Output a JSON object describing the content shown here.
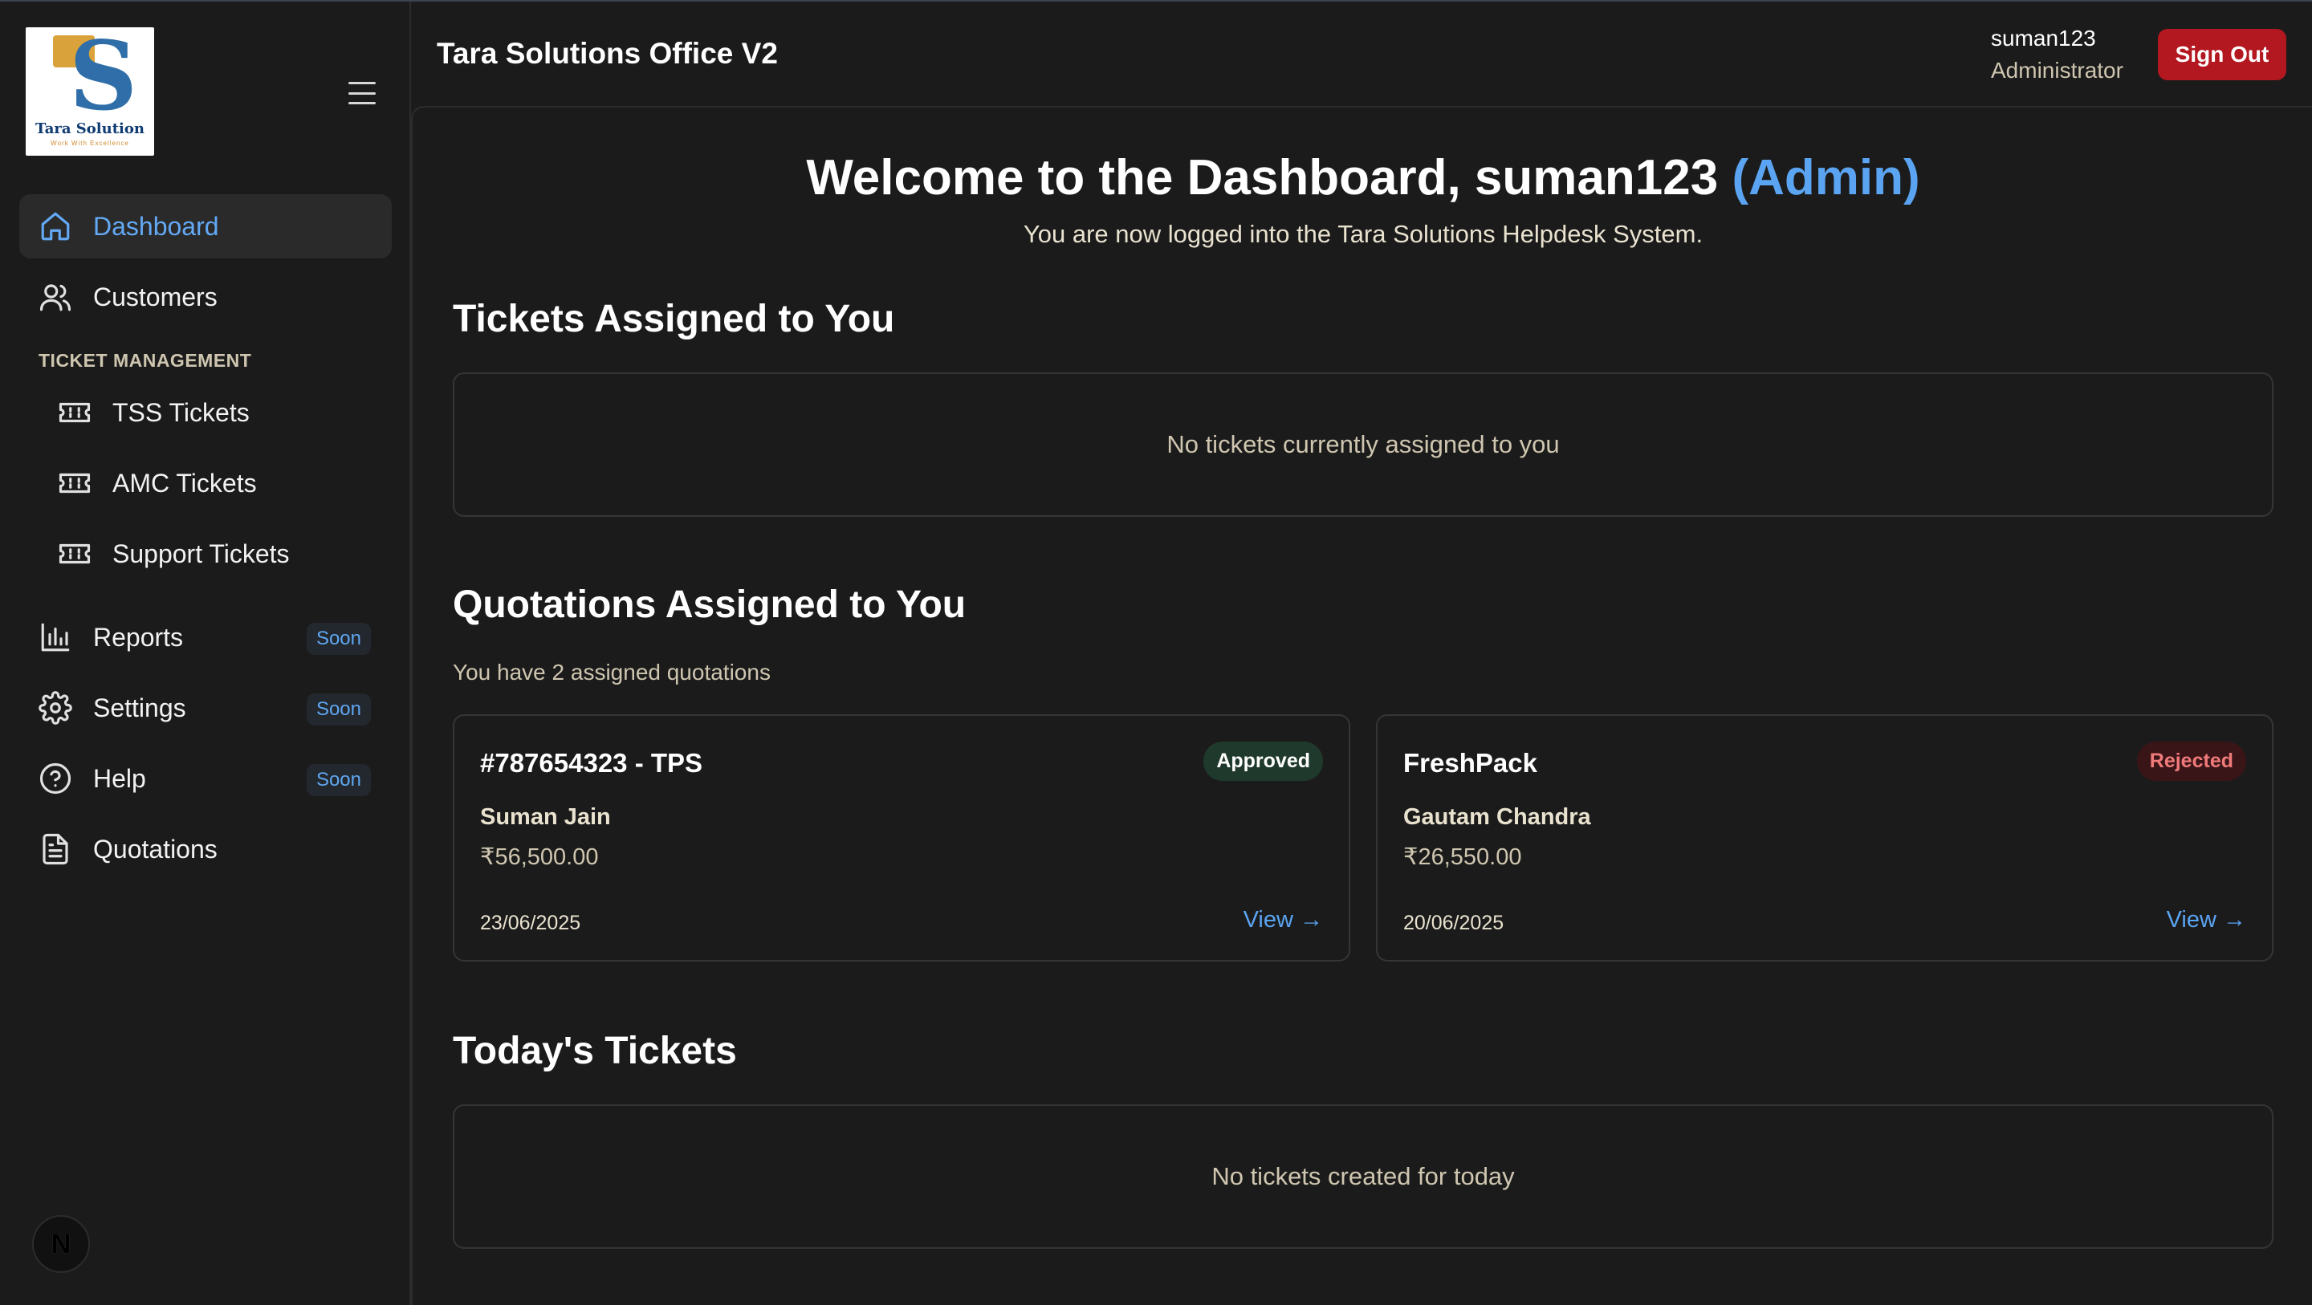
{
  "brand": {
    "logo_name": "Tara Solution",
    "logo_tagline": "Work With Excellence"
  },
  "header": {
    "title": "Tara Solutions Office V2",
    "user_name": "suman123",
    "user_role": "Administrator",
    "signout_label": "Sign Out"
  },
  "sidebar": {
    "items": [
      {
        "label": "Dashboard",
        "icon": "home-icon"
      },
      {
        "label": "Customers",
        "icon": "users-icon"
      }
    ],
    "section_label": "TICKET MANAGEMENT",
    "ticket_items": [
      {
        "label": "TSS Tickets",
        "icon": "ticket-icon"
      },
      {
        "label": "AMC Tickets",
        "icon": "ticket-icon"
      },
      {
        "label": "Support Tickets",
        "icon": "ticket-icon"
      }
    ],
    "other_items": [
      {
        "label": "Reports",
        "icon": "bar-chart-icon",
        "badge": "Soon"
      },
      {
        "label": "Settings",
        "icon": "gear-icon",
        "badge": "Soon"
      },
      {
        "label": "Help",
        "icon": "help-circle-icon",
        "badge": "Soon"
      },
      {
        "label": "Quotations",
        "icon": "document-icon"
      }
    ],
    "bottom_badge": "N"
  },
  "main": {
    "welcome_prefix": "Welcome to the Dashboard, suman123",
    "welcome_role": "(Admin)",
    "welcome_sub": "You are now logged into the Tara Solutions Helpdesk System.",
    "assigned_tickets": {
      "title": "Tickets Assigned to You",
      "empty": "No tickets currently assigned to you"
    },
    "quotations": {
      "title": "Quotations Assigned to You",
      "count_text": "You have 2 assigned quotations",
      "items": [
        {
          "title": "#787654323 - TPS",
          "status": "Approved",
          "client": "Suman Jain",
          "amount": "₹56,500.00",
          "date": "23/06/2025",
          "view": "View →"
        },
        {
          "title": "FreshPack",
          "status": "Rejected",
          "client": "Gautam Chandra",
          "amount": "₹26,550.00",
          "date": "20/06/2025",
          "view": "View →"
        }
      ]
    },
    "todays_tickets": {
      "title": "Today's Tickets",
      "empty": "No tickets created for today"
    }
  },
  "colors": {
    "accent": "#5aa4f2",
    "signout": "#b3171f",
    "approved_bg": "#1f3a2c",
    "rejected_bg": "#3a1518",
    "rejected_text": "#f07a7a"
  }
}
